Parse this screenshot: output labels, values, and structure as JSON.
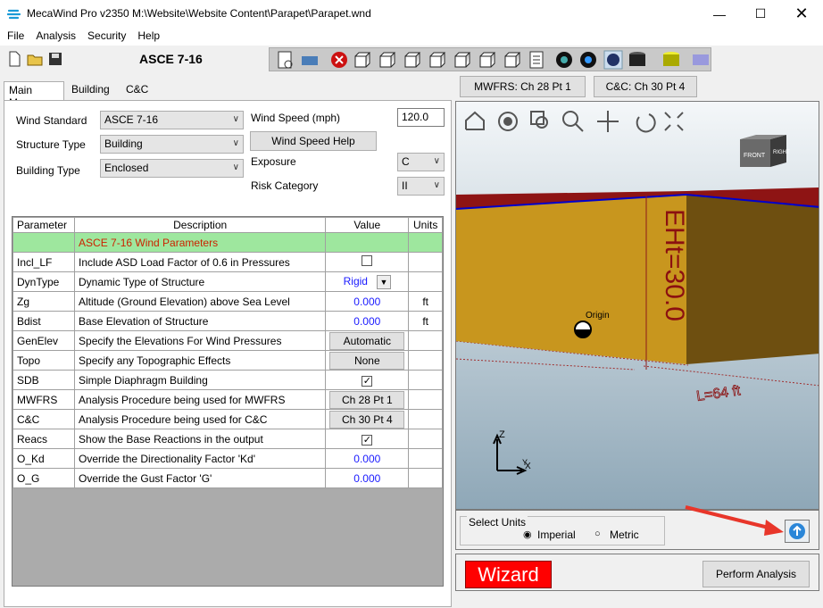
{
  "title": "MecaWind Pro v2350 M:\\Website\\Website Content\\Parapet\\Parapet.wnd",
  "menu": [
    "File",
    "Analysis",
    "Security",
    "Help"
  ],
  "standard_label": "ASCE 7-16",
  "tabs": [
    "Main Menu",
    "Building",
    "C&C"
  ],
  "right_tabs": [
    "MWFRS: Ch 28 Pt 1",
    "C&C: Ch 30 Pt 4"
  ],
  "form": {
    "wind_standard_label": "Wind Standard",
    "wind_standard_value": "ASCE 7-16",
    "structure_type_label": "Structure Type",
    "structure_type_value": "Building",
    "building_type_label": "Building Type",
    "building_type_value": "Enclosed",
    "wind_speed_label": "Wind Speed (mph)",
    "wind_speed_value": "120.0",
    "wind_speed_help": "Wind Speed Help",
    "exposure_label": "Exposure",
    "exposure_value": "C",
    "risk_label": "Risk Category",
    "risk_value": "II"
  },
  "grid": {
    "headers": [
      "Parameter",
      "Description",
      "Value",
      "Units"
    ],
    "title_row": "ASCE 7-16 Wind Parameters",
    "rows": [
      {
        "p": "Incl_LF",
        "d": "Include ASD Load Factor of 0.6 in Pressures",
        "v": "",
        "u": "",
        "kind": "check",
        "checked": false
      },
      {
        "p": "DynType",
        "d": "Dynamic Type of Structure",
        "v": "Rigid",
        "u": "",
        "kind": "combo"
      },
      {
        "p": "Zg",
        "d": "Altitude (Ground Elevation) above Sea Level",
        "v": "0.000",
        "u": "ft",
        "kind": "num"
      },
      {
        "p": "Bdist",
        "d": "Base Elevation of Structure",
        "v": "0.000",
        "u": "ft",
        "kind": "num"
      },
      {
        "p": "GenElev",
        "d": "Specify the Elevations For Wind Pressures",
        "v": "Automatic",
        "u": "",
        "kind": "btn"
      },
      {
        "p": "Topo",
        "d": "Specify any Topographic Effects",
        "v": "None",
        "u": "",
        "kind": "btn"
      },
      {
        "p": "SDB",
        "d": "Simple Diaphragm Building",
        "v": "",
        "u": "",
        "kind": "check",
        "checked": true
      },
      {
        "p": "MWFRS",
        "d": "Analysis Procedure being used for MWFRS",
        "v": "Ch 28 Pt 1",
        "u": "",
        "kind": "btn"
      },
      {
        "p": "C&C",
        "d": "Analysis Procedure being used for C&C",
        "v": "Ch 30 Pt 4",
        "u": "",
        "kind": "btn"
      },
      {
        "p": "Reacs",
        "d": "Show the Base Reactions in the output",
        "v": "",
        "u": "",
        "kind": "check",
        "checked": true
      },
      {
        "p": "O_Kd",
        "d": "Override the Directionality Factor 'Kd'",
        "v": "0.000",
        "u": "",
        "kind": "num"
      },
      {
        "p": "O_G",
        "d": "Override the Gust Factor 'G'",
        "v": "0.000",
        "u": "",
        "kind": "num"
      }
    ]
  },
  "viewport": {
    "eht_label": "EHt=30.0",
    "origin_label": "Origin",
    "len_label": "L=64 ft",
    "cube_front": "FRONT",
    "cube_right": "RIGHT",
    "axis_z": "Z",
    "axis_x": "X",
    "axis_y": "Y"
  },
  "units": {
    "group_label": "Select Units",
    "imperial": "Imperial",
    "metric": "Metric",
    "selected": "Imperial"
  },
  "wizard": "Wizard",
  "perform": "Perform Analysis"
}
